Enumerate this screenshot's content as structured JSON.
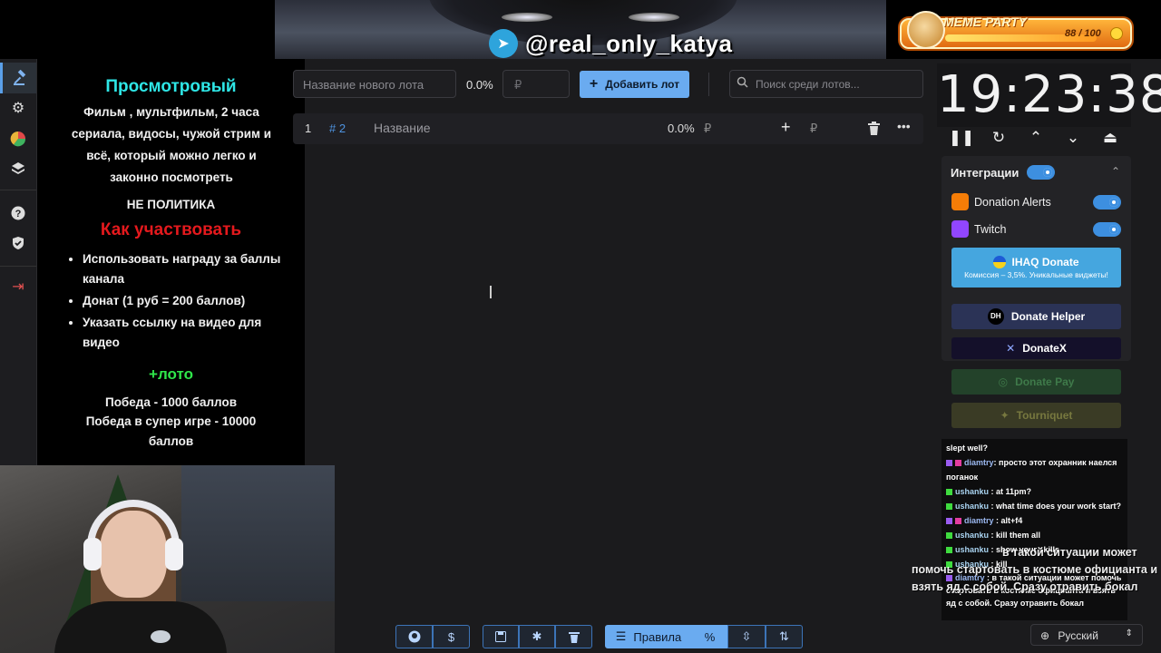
{
  "banner": {
    "telegram_handle": "@real_only_katya",
    "meme_title": "MEME PARTY",
    "meme_count": "88 / 100",
    "meme_progress": 0.88
  },
  "sidebar": {
    "items": [
      {
        "icon": "gavel-icon"
      },
      {
        "icon": "gear-icon"
      },
      {
        "icon": "pie-chart-icon"
      },
      {
        "icon": "layers-icon"
      },
      {
        "icon": "help-icon"
      },
      {
        "icon": "shield-check-icon"
      },
      {
        "icon": "logout-icon"
      }
    ]
  },
  "rules": {
    "title": "Просмотровый",
    "description": "Фильм , мультфильм, 2 часа сериала, видосы, чужой стрим и всё, который можно легко и законно посмотреть",
    "no_politics": "НЕ ПОЛИТИКА",
    "how_title": "Как участвовать",
    "how_items": [
      "Использовать награду за баллы канала",
      "Донат (1 руб = 200 баллов)",
      "Указать ссылку на видео для видео"
    ],
    "loto_title": "+лото",
    "prize1": "Победа - 1000 баллов",
    "prize2": "Победа в супер игре - 10000 баллов"
  },
  "toolbar": {
    "new_lot_placeholder": "Название нового лота",
    "percent": "0.0%",
    "sum_placeholder": "₽",
    "add_label": "Добавить лот",
    "search_placeholder": "Поиск среди лотов..."
  },
  "lots": [
    {
      "index": "1",
      "id": "# 2",
      "name_placeholder": "Название",
      "percent": "0.0%",
      "sum": "₽",
      "extra": "₽"
    }
  ],
  "timer": {
    "time": "19:23:38"
  },
  "integrations": {
    "title": "Интеграции",
    "items": [
      {
        "label": "Donation Alerts",
        "enabled": true
      },
      {
        "label": "Twitch",
        "enabled": true
      }
    ],
    "cards": [
      {
        "title": "IHAQ Donate",
        "subtitle": "Комиссия – 3,5%. Уникальные виджеты!"
      },
      {
        "title": "Donate Helper"
      },
      {
        "title": "DonateX"
      },
      {
        "title": "Donate Pay"
      },
      {
        "title": "Tourniquet"
      }
    ]
  },
  "chat": {
    "messages": [
      {
        "user": "",
        "text": "slept well?"
      },
      {
        "user": "diamtry",
        "text": "просто этот охранник наелся поганок"
      },
      {
        "user": "ushanku",
        "text": "at 11pm?"
      },
      {
        "user": "ushanku",
        "text": "what time does your work start?"
      },
      {
        "user": "diamtry",
        "text": "alt+f4"
      },
      {
        "user": "ushanku",
        "text": "kill them all"
      },
      {
        "user": "ushanku",
        "text": "show your skills"
      },
      {
        "user": "ushanku",
        "text": "kill"
      },
      {
        "user": "diamtry",
        "text": "в такой ситуации может помочь стартовать в костюме официанта и взять яд с собой. Сразу отравить бокал"
      }
    ],
    "ghost_line1": "в такой ситуации может",
    "ghost_line2": "помочь стартовать в костюме официанта и",
    "ghost_line3": "взять яд с собой. Сразу отравить бокал"
  },
  "bottom": {
    "rules_label": "Правила",
    "language": "Русский"
  }
}
